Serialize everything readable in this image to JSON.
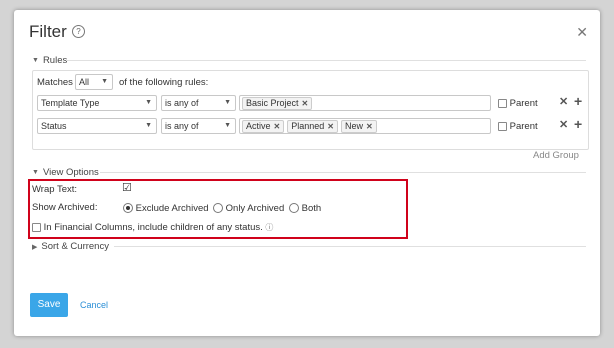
{
  "dialog": {
    "title": "Filter",
    "help_icon": "?",
    "close_icon": "✕"
  },
  "rules": {
    "section_label": "Rules",
    "matches_label": "Matches",
    "matches_value": "All",
    "matches_suffix": "of the following rules:",
    "rows": [
      {
        "field": "Template Type",
        "operator": "is any of",
        "values": [
          "Basic Project"
        ],
        "parent_label": "Parent",
        "parent_checked": false
      },
      {
        "field": "Status",
        "operator": "is any of",
        "values": [
          "Active",
          "Planned",
          "New"
        ],
        "parent_label": "Parent",
        "parent_checked": false
      }
    ],
    "add_group": "Add Group"
  },
  "view_options": {
    "section_label": "View Options",
    "wrap_text_label": "Wrap Text:",
    "wrap_text_checked": true,
    "show_archived_label": "Show Archived:",
    "archived_options": [
      "Exclude Archived",
      "Only Archived",
      "Both"
    ],
    "archived_selected": "Exclude Archived",
    "financial_label": "In Financial Columns, include children of any status.",
    "financial_checked": false
  },
  "sort_currency": {
    "section_label": "Sort & Currency"
  },
  "footer": {
    "save_label": "Save",
    "cancel_label": "Cancel"
  },
  "colors": {
    "accent": "#3aa6e8",
    "highlight": "#d0021b",
    "link": "#2b8fd6"
  }
}
